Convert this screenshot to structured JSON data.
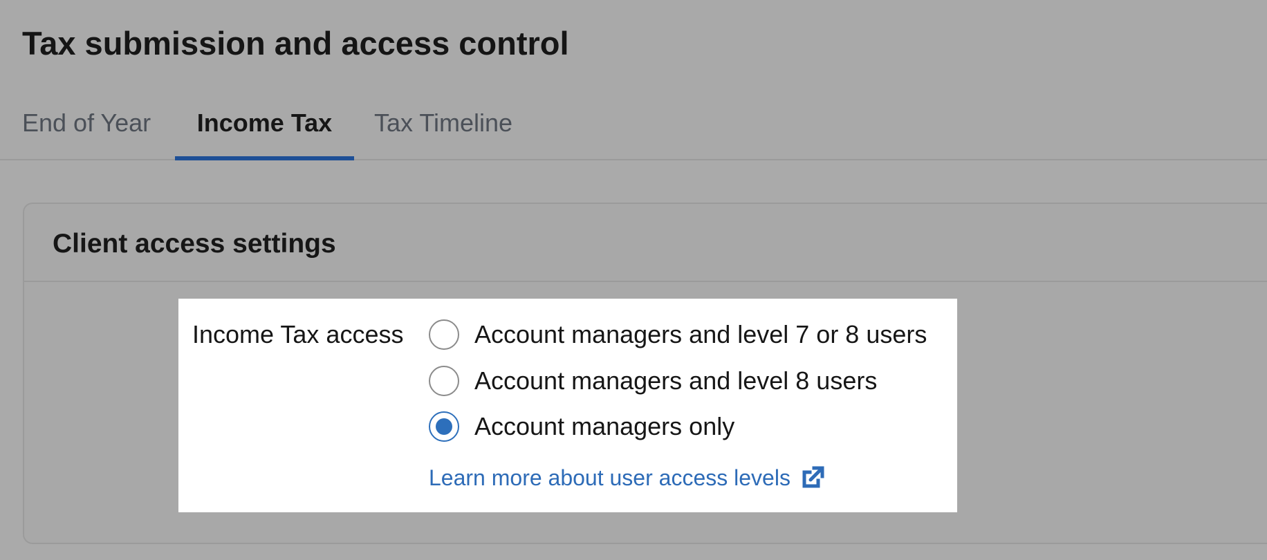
{
  "page": {
    "title": "Tax submission and access control"
  },
  "tabs": [
    {
      "label": "End of Year",
      "active": false
    },
    {
      "label": "Income Tax",
      "active": true
    },
    {
      "label": "Tax Timeline",
      "active": false
    }
  ],
  "card": {
    "title": "Client access settings",
    "setting": {
      "label": "Income Tax access",
      "options": [
        {
          "label": "Account managers and level 7 or 8 users",
          "selected": false
        },
        {
          "label": "Account managers and level 8 users",
          "selected": false
        },
        {
          "label": "Account managers only",
          "selected": true
        }
      ],
      "help_link": {
        "label": "Learn more about user access levels",
        "icon": "external-link-icon"
      }
    }
  },
  "colors": {
    "accent": "#2d6fbb",
    "tab_indicator": "#1e4f96",
    "background": "#aaaaaa",
    "panel": "#ffffff"
  }
}
